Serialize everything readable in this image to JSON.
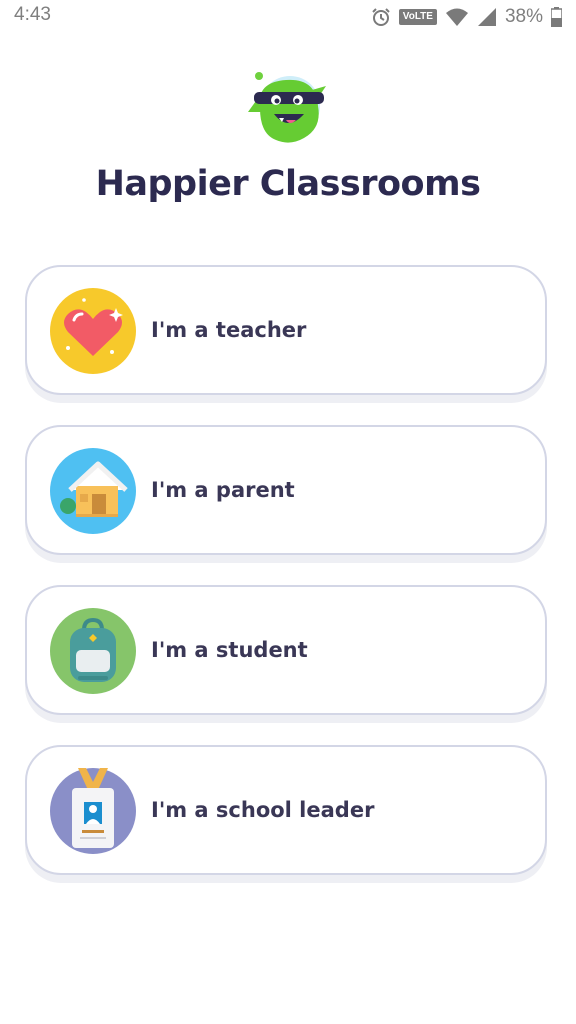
{
  "status_bar": {
    "time": "4:43",
    "network_badge": "VoLTE",
    "battery_percent": "38%",
    "icons": [
      "alarm-icon",
      "wifi-icon",
      "cell-signal-icon",
      "battery-icon"
    ]
  },
  "app": {
    "logo_icon": "classdojo-monster-logo",
    "title": "Happier Classrooms"
  },
  "roles": [
    {
      "label": "I'm a teacher",
      "icon": "heart-icon",
      "color": "#f7c92b"
    },
    {
      "label": "I'm a parent",
      "icon": "house-icon",
      "color": "#4fc0f2"
    },
    {
      "label": "I'm a student",
      "icon": "backpack-icon",
      "color": "#86c56a"
    },
    {
      "label": "I'm a school leader",
      "icon": "id-badge-icon",
      "color": "#8a8fc8"
    }
  ],
  "colors": {
    "title": "#2c2a50",
    "card_border": "#d3d6e6",
    "label": "#3a3756"
  }
}
